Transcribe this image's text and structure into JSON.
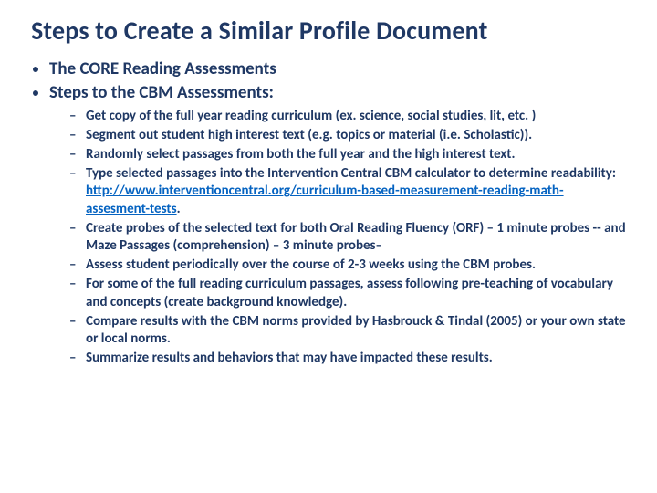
{
  "title": "Steps to Create a Similar Profile Document",
  "level1": [
    "The CORE Reading Assessments",
    "Steps to the CBM Assessments:"
  ],
  "level2": [
    {
      "pre": "Get copy of the full year reading curriculum (ex. science, social studies, lit, etc. )"
    },
    {
      "pre": "Segment out student high interest text (e.g. topics or material (i.e. Scholastic))."
    },
    {
      "pre": "Randomly select passages from both the full year and the high interest text."
    },
    {
      "pre": "Type selected passages into the Intervention Central CBM calculator to determine readability:  ",
      "link": "http://www.interventioncentral.org/curriculum-based-measurement-reading-math-assesment-tests",
      "post": "."
    },
    {
      "pre": "Create probes of the selected text for both Oral Reading Fluency (ORF) – 1 minute probes -- and Maze Passages (comprehension) – 3 minute probes–"
    },
    {
      "pre": "Assess student periodically over the course of 2-3 weeks using the CBM probes."
    },
    {
      "pre": "For some of the full reading curriculum passages, assess following pre-teaching of vocabulary and concepts (create background knowledge)."
    },
    {
      "pre": "Compare results with the CBM norms provided by Hasbrouck & Tindal (2005) or your own state or local norms."
    },
    {
      "pre": "Summarize results and behaviors that may have impacted these results."
    }
  ]
}
